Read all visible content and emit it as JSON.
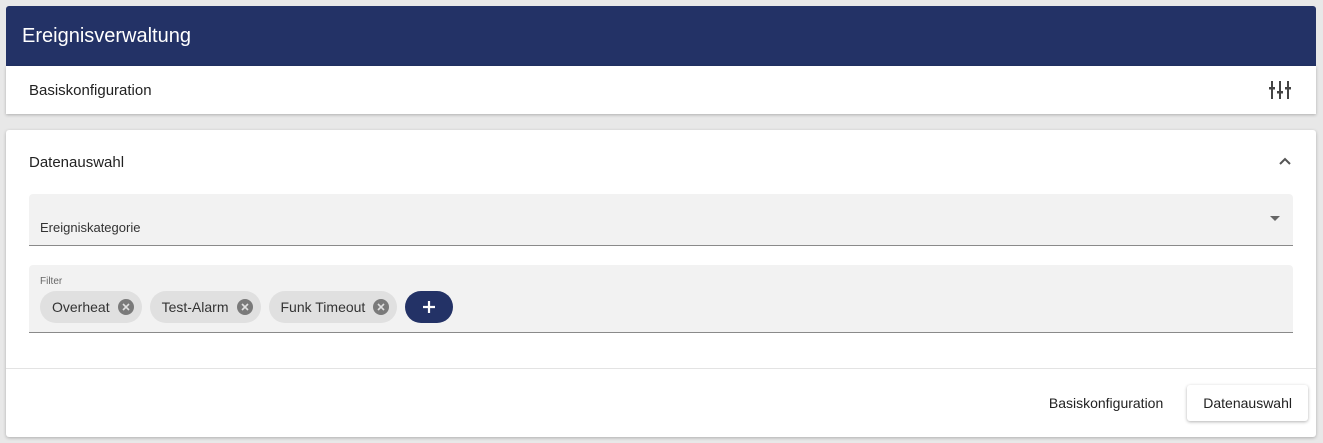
{
  "header": {
    "title": "Ereignisverwaltung"
  },
  "basis": {
    "label": "Basiskonfiguration",
    "icon": "tune-icon"
  },
  "panel": {
    "title": "Datenauswahl",
    "category_field": {
      "label": "Ereigniskategorie",
      "value": ""
    },
    "filter_field": {
      "label": "Filter",
      "chips": [
        "Overheat",
        "Test-Alarm",
        "Funk Timeout"
      ],
      "add_icon": "plus-icon"
    }
  },
  "footer": {
    "basis_button": "Basiskonfiguration",
    "data_button": "Datenauswahl"
  },
  "colors": {
    "primary": "#233266",
    "field_bg": "#f2f2f2",
    "chip_bg": "#e0e0e0"
  }
}
